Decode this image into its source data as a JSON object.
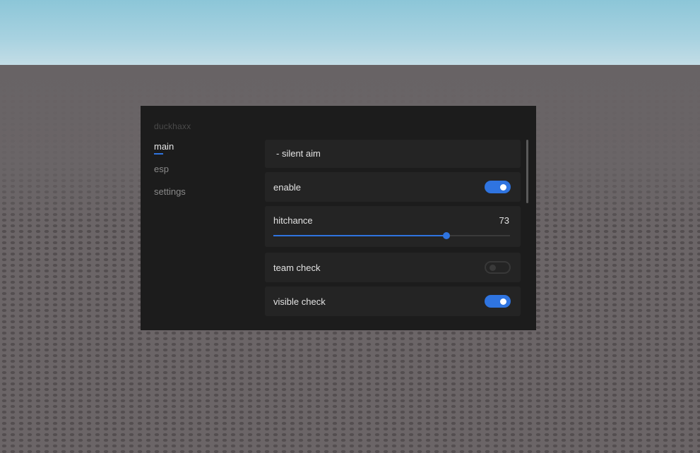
{
  "app": {
    "brand": "duckhaxx"
  },
  "tabs": [
    {
      "label": "main",
      "active": true
    },
    {
      "label": "esp",
      "active": false
    },
    {
      "label": "settings",
      "active": false
    }
  ],
  "section": {
    "title": "- silent aim"
  },
  "options": {
    "enable": {
      "label": "enable",
      "on": true
    },
    "hitchance": {
      "label": "hitchance",
      "value": "73",
      "min": 0,
      "max": 100
    },
    "team_check": {
      "label": "team check",
      "on": false
    },
    "visible_check": {
      "label": "visible check",
      "on": true
    }
  },
  "colors": {
    "accent": "#2f74e0",
    "panel": "#1c1c1c",
    "row": "#242424"
  }
}
